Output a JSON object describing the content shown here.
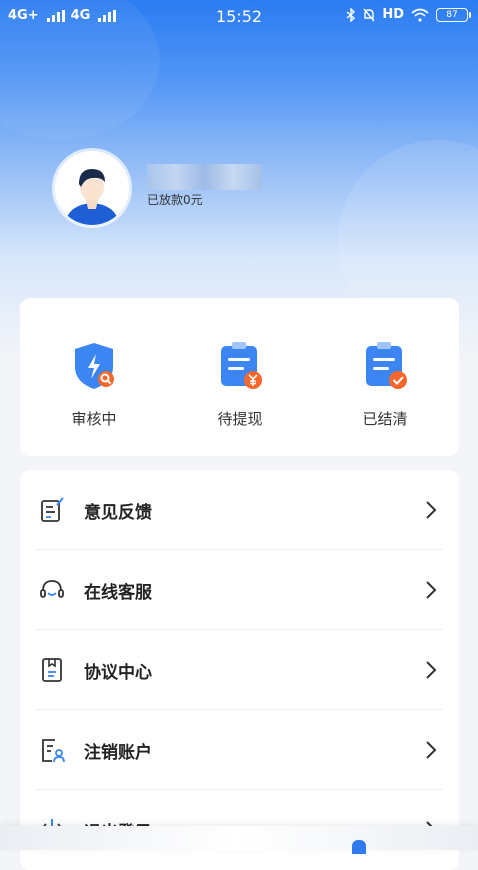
{
  "status_bar": {
    "network1": "4G+",
    "network2": "4G",
    "time": "15:52",
    "hd_label": "HD",
    "battery": "87"
  },
  "profile": {
    "loan_text": "已放款0元"
  },
  "stats": [
    {
      "label": "审核中",
      "icon": "shield-search-icon"
    },
    {
      "label": "待提现",
      "icon": "clipboard-yuan-icon"
    },
    {
      "label": "已结清",
      "icon": "clipboard-check-icon"
    }
  ],
  "menu": [
    {
      "label": "意见反馈",
      "icon": "feedback-icon"
    },
    {
      "label": "在线客服",
      "icon": "headset-icon"
    },
    {
      "label": "协议中心",
      "icon": "agreement-icon"
    },
    {
      "label": "注销账户",
      "icon": "cancel-account-icon"
    },
    {
      "label": "退出登录",
      "icon": "power-icon"
    }
  ],
  "colors": {
    "brand_blue": "#2e7bf0",
    "accent_orange": "#f5672a"
  }
}
